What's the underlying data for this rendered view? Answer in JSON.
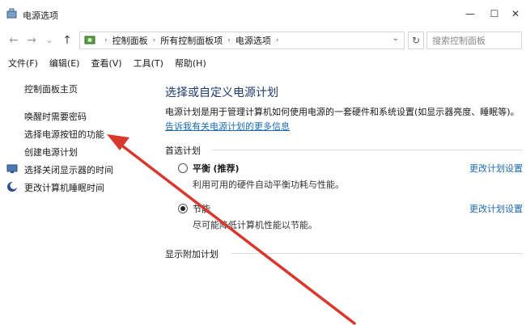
{
  "window": {
    "title": "电源选项",
    "icon": "power-options-icon",
    "minimize_icon": "—",
    "maximize_icon": "☐",
    "close_icon": "✕"
  },
  "nav": {
    "back_icon": "←",
    "forward_icon": "→",
    "dropdown_icon": "⌄",
    "up_icon": "↑",
    "breadcrumbs": [
      "控制面板",
      "所有控制面板项",
      "电源选项"
    ],
    "breadcrumb_separator": "›",
    "address_dropdown_icon": "⌄",
    "refresh_icon": "↻",
    "search_placeholder": "搜索控制面板"
  },
  "menu": {
    "items": [
      "文件(F)",
      "编辑(E)",
      "查看(V)",
      "工具(T)",
      "帮助(H)"
    ]
  },
  "sidebar": {
    "home": "控制面板主页",
    "links": [
      {
        "label": "唤醒时需要密码",
        "icon": ""
      },
      {
        "label": "选择电源按钮的功能",
        "icon": ""
      },
      {
        "label": "创建电源计划",
        "icon": ""
      },
      {
        "label": "选择关闭显示器的时间",
        "icon": "monitor-icon"
      },
      {
        "label": "更改计算机睡眠时间",
        "icon": "moon-icon"
      }
    ]
  },
  "main": {
    "title": "选择或自定义电源计划",
    "description": "电源计划是用于管理计算机如何使用电源的一套硬件和系统设置(如显示器亮度、睡眠等)。",
    "link": "告诉我有关电源计划的更多信息",
    "preferred_label": "首选计划",
    "plans": [
      {
        "name": "平衡",
        "tag": "(推荐)",
        "desc": "利用可用的硬件自动平衡功耗与性能。",
        "checked": false,
        "change": "更改计划设置"
      },
      {
        "name": "节能",
        "tag": "",
        "desc": "尽可能降低计算机性能以节能。",
        "checked": true,
        "change": "更改计划设置"
      }
    ],
    "additional_label": "显示附加计划"
  },
  "colors": {
    "title_blue": "#1e3a6e",
    "link_blue": "#1a6ab5",
    "annotation_red": "#d9382f"
  }
}
